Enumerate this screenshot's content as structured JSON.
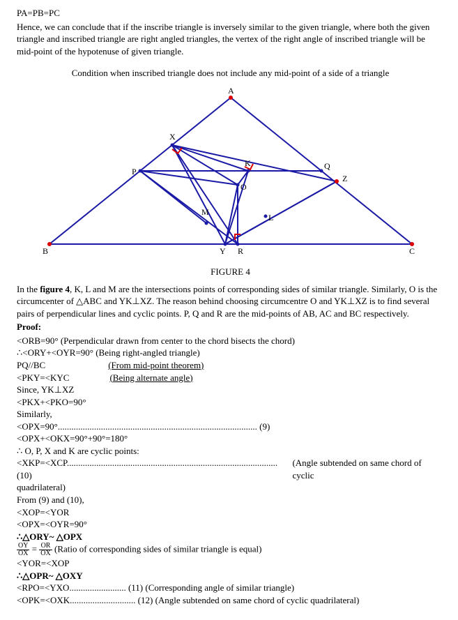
{
  "intro": {
    "line1": "PA=PB=PC",
    "line2": "Hence, we can conclude that if the inscribe triangle is inversely similar to the given triangle, where both the given triangle and inscribed triangle are right angled triangles, the vertex of the right angle of inscribed triangle will be mid-point of the hypotenuse of given triangle."
  },
  "subheading": "Condition when inscribed triangle does not include any mid-point of a side of a triangle",
  "figure": {
    "labels": {
      "A": "A",
      "B": "B",
      "C": "C",
      "P": "P",
      "Q": "Q",
      "R": "R",
      "X": "X",
      "Y": "Y",
      "Z": "Z",
      "K": "K",
      "L": "L",
      "M": "M",
      "O": "O"
    },
    "caption": "FIGURE 4"
  },
  "desc": " In the figure 4, K, L and M are the intersections points of corresponding sides of similar triangle. Similarly, O is the circumcenter of △ABC and YK⊥XZ.  The reason behind choosing circumcentre O and YK⊥XZ is to find several pairs of perpendicular lines and cyclic points. P, Q and R are the mid-points of AB, AC and BC respectively.",
  "desc_bold_figure": "figure 4",
  "proof_label": "Proof:",
  "proof": {
    "l1": "<ORB=90° (Perpendicular drawn from center to the chord bisects the chord)",
    "l2": "∴<ORY+<OYR=90° (Being right-angled triangle)",
    "l3a": "PQ//BC",
    "l3b": "(From mid-point theorem)",
    "l4a": "<PKY=<KYC",
    "l4b": "(Being alternate angle)",
    "l5": " Since, YK⊥XZ",
    "l6": "<PKX+<PKO=90°",
    "l7": "Similarly,",
    "l8": "<OPX=90°........................................................................................ (9)",
    "l9": "<OPX+<OKX=90°+90°=180°",
    "l10": "∴ O, P, X and K are cyclic points:",
    "l11": "<XKP=<XCP............................................................................................. (10)",
    "l11_right": "(Angle subtended on same chord of cyclic",
    "l12": "quadrilateral)",
    "l13": "From (9) and (10),",
    "l14": "<XOP=<YOR",
    "l15": "<OPX=<OYR=90°",
    "l16": "∴△ORY~ △OPX",
    "l17_num1": "OY",
    "l17_den1": "OX",
    "l17_num2": "OR",
    "l17_den2": "OX",
    "l17_rest": " (Ratio of corresponding sides of similar triangle is equal)",
    "l18": "<YOR=<XOP",
    "l19": "∴△OPR~ △OXY",
    "l20": "<RPO=<YXO......................... (11)  (Corresponding angle of similar triangle)",
    "l21": "<OPK=<OXK............................. (12) (Angle subtended on same chord of cyclic quadrilateral)"
  }
}
